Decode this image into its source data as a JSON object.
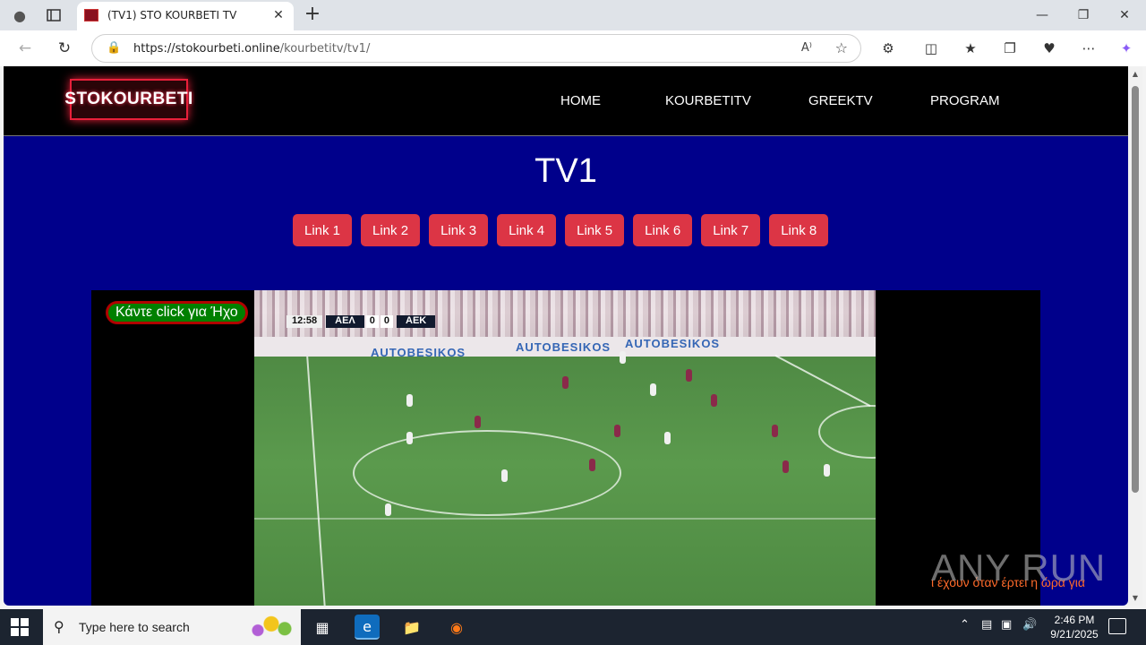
{
  "browser": {
    "tab_title": "(TV1) STO KOURBETI TV",
    "url_host": "https://stokourbeti.online",
    "url_path": "/kourbetitv/tv1/"
  },
  "site": {
    "logo_text": "STOKOURBETI",
    "menu": [
      "HOME",
      "KOURBETITV",
      "GREEKTV",
      "PROGRAM"
    ],
    "page_title": "TV1",
    "links": [
      "Link 1",
      "Link 2",
      "Link 3",
      "Link 4",
      "Link 5",
      "Link 6",
      "Link 7",
      "Link 8"
    ],
    "sound_button": "Κάντε click για Ήχο",
    "ticker_text": "ι έχουν όταν έρτει η ώρα για"
  },
  "video": {
    "clock": "12:58",
    "home_team": "ΑΕΛ",
    "home_score": "0",
    "away_score": "0",
    "away_team": "ΑΕΚ",
    "ad_text": "AUTOBESIKOS"
  },
  "watermark": "ANY RUN",
  "taskbar": {
    "search_placeholder": "Type here to search",
    "time": "2:46 PM",
    "date": "9/21/2025"
  },
  "colors": {
    "page_bg": "#00008b",
    "link_button": "#dc3545",
    "sound_button_bg": "#008000",
    "sound_button_border": "#b00000"
  }
}
